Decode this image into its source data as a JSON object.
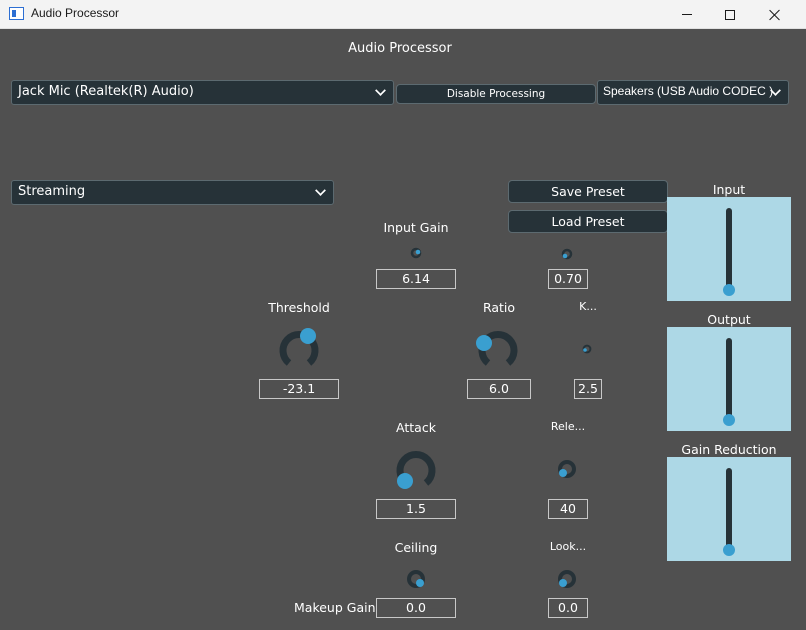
{
  "window": {
    "title": "Audio Processor"
  },
  "header": {
    "title": "Audio Processor"
  },
  "devices": {
    "input": "Jack Mic (Realtek(R) Audio)",
    "output": "Speakers (USB Audio CODEC )",
    "processing_button": "Disable Processing"
  },
  "preset": {
    "selected": "Streaming",
    "save_label": "Save Preset",
    "load_label": "Load Preset"
  },
  "controls": {
    "input_gain": {
      "label": "Input Gain",
      "value": "6.14"
    },
    "input_gain_aux": {
      "value": "0.70"
    },
    "threshold": {
      "label": "Threshold",
      "value": "-23.1"
    },
    "ratio": {
      "label": "Ratio",
      "value": "6.0"
    },
    "knee": {
      "label": "K...",
      "value": "2.5"
    },
    "attack": {
      "label": "Attack",
      "value": "1.5"
    },
    "release": {
      "label": "Rele...",
      "value": "40"
    },
    "ceiling": {
      "label": "Ceiling",
      "value": "0.0"
    },
    "lookahead": {
      "label": "Look...",
      "value": "0.0"
    },
    "makeup_gain": {
      "label": "Makeup Gain"
    }
  },
  "meters": {
    "input": {
      "label": "Input",
      "level": 0.0
    },
    "output": {
      "label": "Output",
      "level": 0.0
    },
    "gain_reduction": {
      "label": "Gain Reduction",
      "level": 0.0
    }
  },
  "colors": {
    "background": "#505050",
    "widget": "#263238",
    "accent": "#3a9fd0",
    "meter_panel": "#add8e6"
  }
}
